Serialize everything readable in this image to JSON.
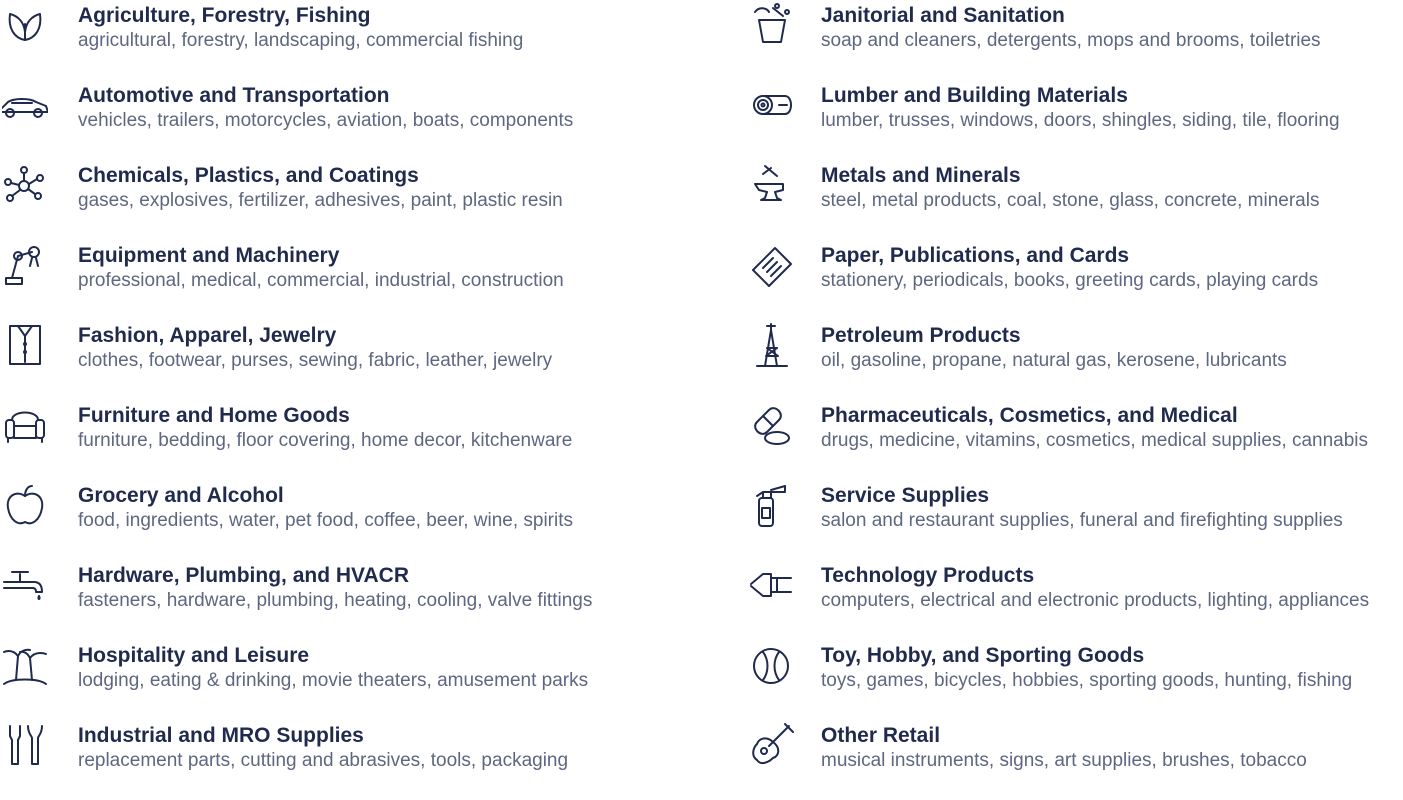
{
  "left": [
    {
      "title": "Agriculture, Forestry, Fishing",
      "desc": "agricultural, forestry, landscaping, commercial fishing",
      "icon": "leaf-icon"
    },
    {
      "title": "Automotive and Transportation",
      "desc": "vehicles, trailers, motorcycles, aviation, boats, components",
      "icon": "car-icon"
    },
    {
      "title": "Chemicals, Plastics, and Coatings",
      "desc": "gases, explosives, fertilizer, adhesives, paint, plastic resin",
      "icon": "molecule-icon"
    },
    {
      "title": "Equipment and Machinery",
      "desc": "professional, medical, commercial, industrial, construction",
      "icon": "robot-arm-icon"
    },
    {
      "title": "Fashion, Apparel, Jewelry",
      "desc": "clothes, footwear, purses, sewing, fabric, leather, jewelry",
      "icon": "shirt-icon"
    },
    {
      "title": "Furniture and Home Goods",
      "desc": "furniture, bedding, floor covering, home decor, kitchenware",
      "icon": "armchair-icon"
    },
    {
      "title": "Grocery and Alcohol",
      "desc": "food, ingredients, water, pet food, coffee, beer, wine, spirits",
      "icon": "apple-icon"
    },
    {
      "title": "Hardware, Plumbing, and HVACR",
      "desc": "fasteners, hardware, plumbing, heating, cooling, valve fittings",
      "icon": "faucet-icon"
    },
    {
      "title": "Hospitality and Leisure",
      "desc": "lodging, eating & drinking, movie theaters, amusement parks",
      "icon": "palm-island-icon"
    },
    {
      "title": "Industrial and MRO Supplies",
      "desc": "replacement parts, cutting and abrasives, tools, packaging",
      "icon": "tools-icon"
    }
  ],
  "right": [
    {
      "title": "Janitorial and Sanitation",
      "desc": "soap and cleaners, detergents, mops and brooms, toiletries",
      "icon": "bucket-icon"
    },
    {
      "title": "Lumber and Building Materials",
      "desc": "lumber, trusses, windows, doors, shingles, siding, tile, flooring",
      "icon": "log-icon"
    },
    {
      "title": "Metals and Minerals",
      "desc": "steel, metal products, coal, stone, glass, concrete, minerals",
      "icon": "anvil-icon"
    },
    {
      "title": "Paper, Publications, and Cards",
      "desc": "stationery, periodicals, books, greeting cards, playing cards",
      "icon": "newspaper-icon"
    },
    {
      "title": "Petroleum Products",
      "desc": "oil, gasoline, propane, natural gas, kerosene, lubricants",
      "icon": "oil-derrick-icon"
    },
    {
      "title": "Pharmaceuticals, Cosmetics, and Medical",
      "desc": "drugs, medicine, vitamins, cosmetics, medical supplies, cannabis",
      "icon": "pills-icon"
    },
    {
      "title": "Service Supplies",
      "desc": "salon and restaurant supplies, funeral and firefighting supplies",
      "icon": "fire-extinguisher-icon"
    },
    {
      "title": "Technology Products",
      "desc": "computers, electrical and electronic products, lighting, appliances",
      "icon": "plug-icon"
    },
    {
      "title": "Toy, Hobby, and Sporting Goods",
      "desc": "toys, games, bicycles, hobbies, sporting goods, hunting, fishing",
      "icon": "baseball-icon"
    },
    {
      "title": "Other Retail",
      "desc": "musical instruments, signs, art supplies, brushes, tobacco",
      "icon": "guitar-icon"
    }
  ]
}
